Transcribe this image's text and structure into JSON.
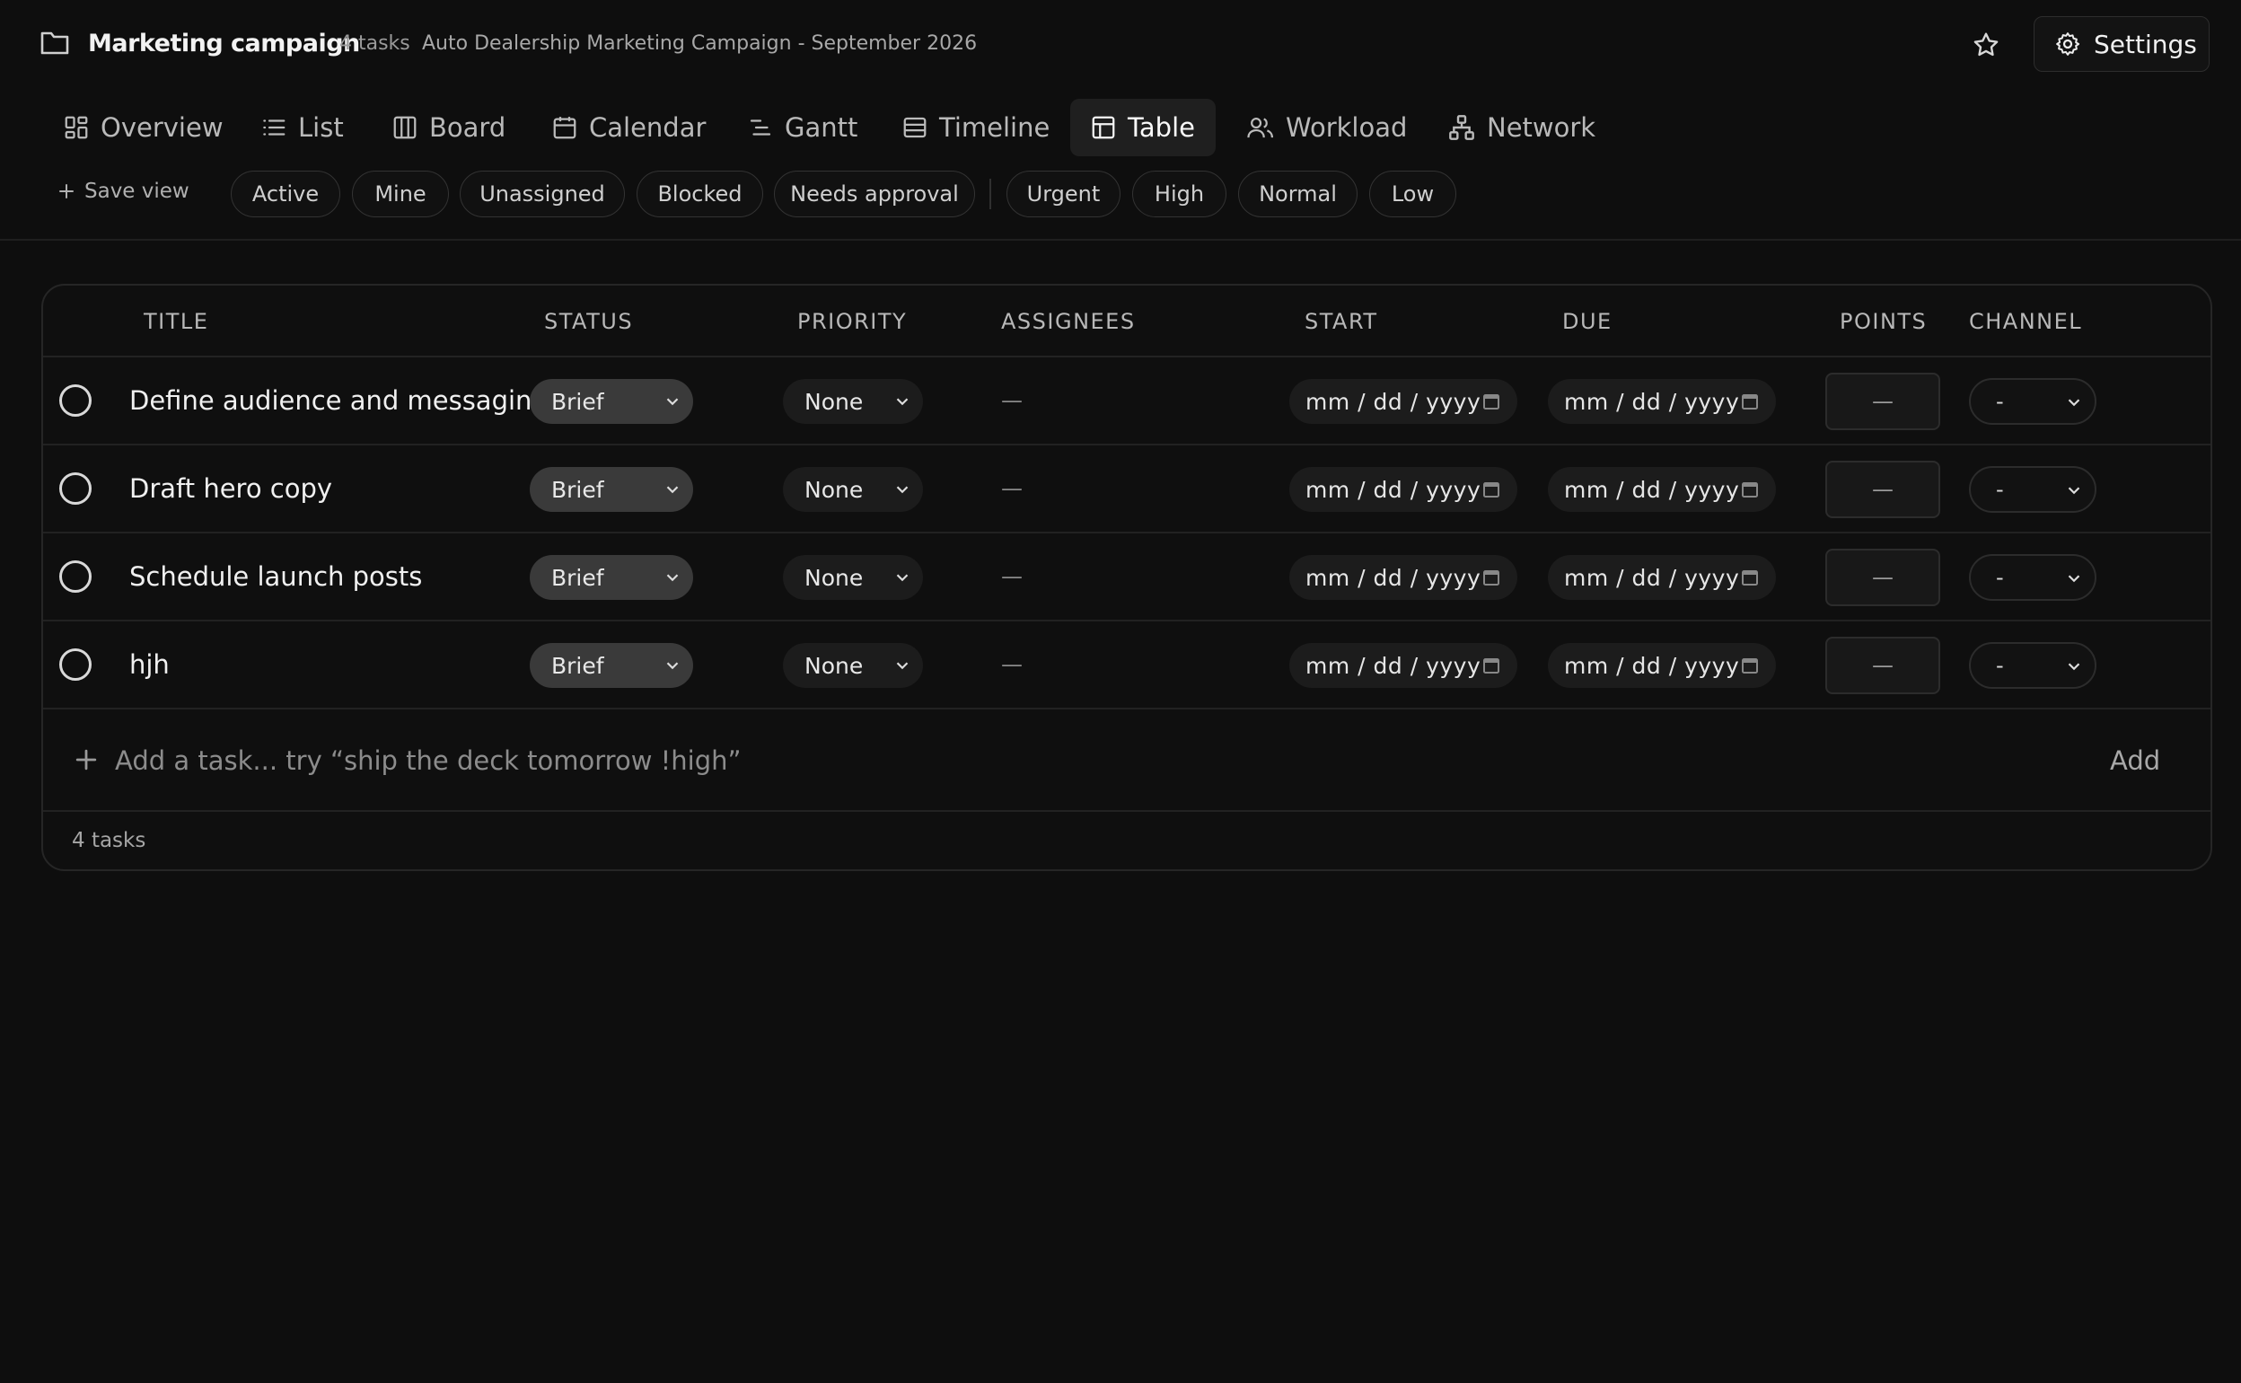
{
  "header": {
    "title": "Marketing campaign",
    "task_count": "4 tasks",
    "subtitle": "Auto Dealership Marketing Campaign - September 2026",
    "settings_label": "Settings"
  },
  "tabs": [
    {
      "label": "Overview",
      "icon": "grid-icon"
    },
    {
      "label": "List",
      "icon": "list-icon"
    },
    {
      "label": "Board",
      "icon": "columns-icon"
    },
    {
      "label": "Calendar",
      "icon": "calendar-icon"
    },
    {
      "label": "Gantt",
      "icon": "gantt-icon"
    },
    {
      "label": "Timeline",
      "icon": "timeline-icon"
    },
    {
      "label": "Table",
      "icon": "table-icon",
      "active": true
    },
    {
      "label": "Workload",
      "icon": "users-icon"
    },
    {
      "label": "Network",
      "icon": "network-icon"
    }
  ],
  "filters": {
    "save_view": "Save view",
    "chips": [
      "Active",
      "Mine",
      "Unassigned",
      "Blocked",
      "Needs approval",
      "Urgent",
      "High",
      "Normal",
      "Low"
    ]
  },
  "table": {
    "columns": [
      "TITLE",
      "STATUS",
      "PRIORITY",
      "ASSIGNEES",
      "START",
      "DUE",
      "POINTS",
      "CHANNEL"
    ],
    "rows": [
      {
        "title": "Define audience and messaging",
        "status": "Brief",
        "priority": "None",
        "assignees": "—",
        "start": "mm / dd / yyyy",
        "due": "mm / dd / yyyy",
        "points": "—",
        "channel": "-"
      },
      {
        "title": "Draft hero copy",
        "status": "Brief",
        "priority": "None",
        "assignees": "—",
        "start": "mm / dd / yyyy",
        "due": "mm / dd / yyyy",
        "points": "—",
        "channel": "-"
      },
      {
        "title": "Schedule launch posts",
        "status": "Brief",
        "priority": "None",
        "assignees": "—",
        "start": "mm / dd / yyyy",
        "due": "mm / dd / yyyy",
        "points": "—",
        "channel": "-"
      },
      {
        "title": "hjh",
        "status": "Brief",
        "priority": "None",
        "assignees": "—",
        "start": "mm / dd / yyyy",
        "due": "mm / dd / yyyy",
        "points": "—",
        "channel": "-"
      }
    ],
    "add_placeholder": "Add a task... try “ship the deck tomorrow !high”",
    "add_button": "Add",
    "footer_count": "4 tasks"
  }
}
